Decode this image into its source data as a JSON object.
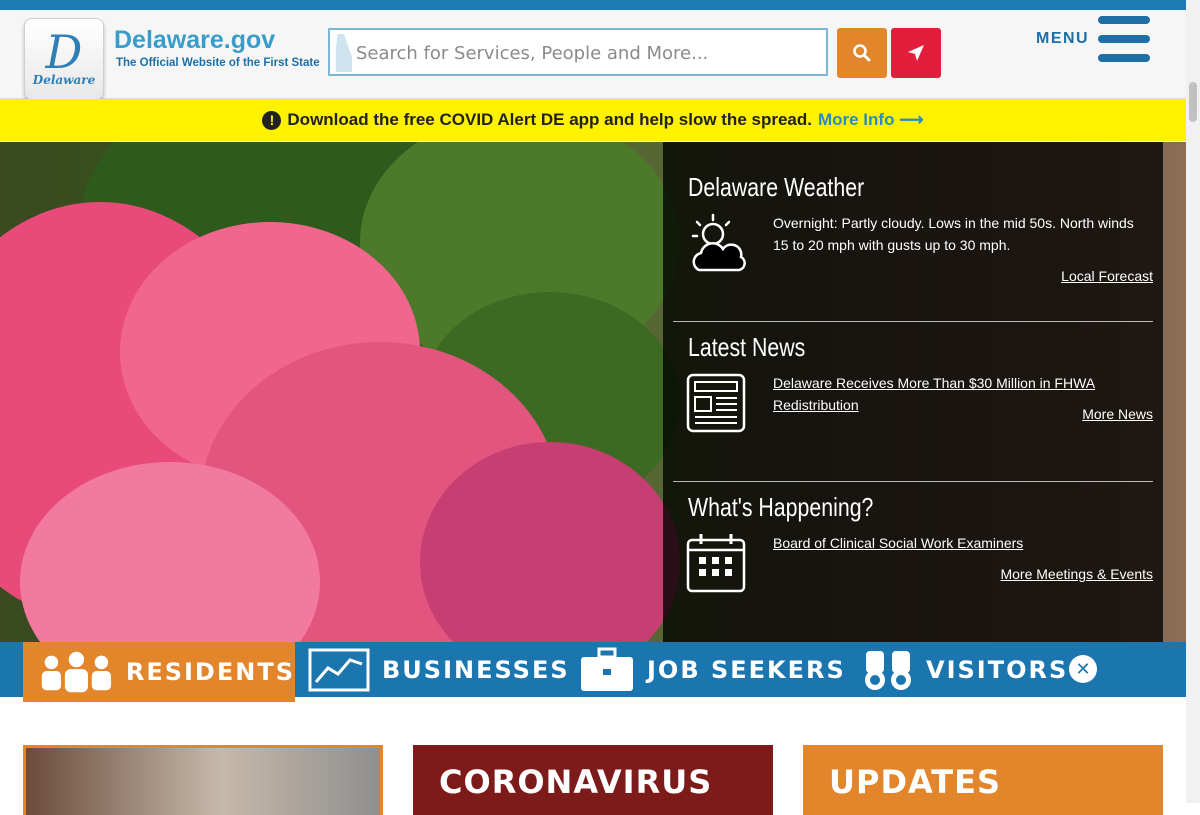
{
  "header": {
    "logo_letter": "D",
    "logo_word": "Delaware",
    "site_name": "Delaware.gov",
    "site_subtitle": "The Official Website of the First State",
    "search_placeholder": "Search for Services, People and More...",
    "search_icon": "search-icon",
    "locate_icon": "location-arrow-icon",
    "menu_label": "MENU"
  },
  "alert": {
    "text": "Download the free COVID Alert DE app and help slow the spread.",
    "link": "More Info",
    "arrow": "⟶"
  },
  "hero": {
    "weather": {
      "heading": "Delaware Weather",
      "text": "Overnight: Partly cloudy. Lows in the mid 50s. North winds 15 to 20 mph with gusts up to 30 mph.",
      "link": "Local Forecast"
    },
    "news": {
      "heading": "Latest News",
      "headline": "Delaware Receives More Than $30 Million in FHWA Redistribution",
      "link": "More News"
    },
    "events": {
      "heading": "What's Happening?",
      "item": "Board of Clinical Social Work Examiners",
      "link": "More Meetings & Events"
    }
  },
  "audience": {
    "residents": "RESIDENTS",
    "businesses": "BUSINESSES",
    "job_seekers": "JOB SEEKERS",
    "visitors": "VISITORS",
    "close": "✕"
  },
  "cards": {
    "coronavirus": "CORONAVIRUS",
    "updates": "UPDATES"
  },
  "colors": {
    "brand_blue": "#1b75ae",
    "accent_orange": "#e2852b",
    "accent_red": "#e31d3c",
    "alert_yellow": "#fff200",
    "corona_red": "#7d1a1a"
  }
}
